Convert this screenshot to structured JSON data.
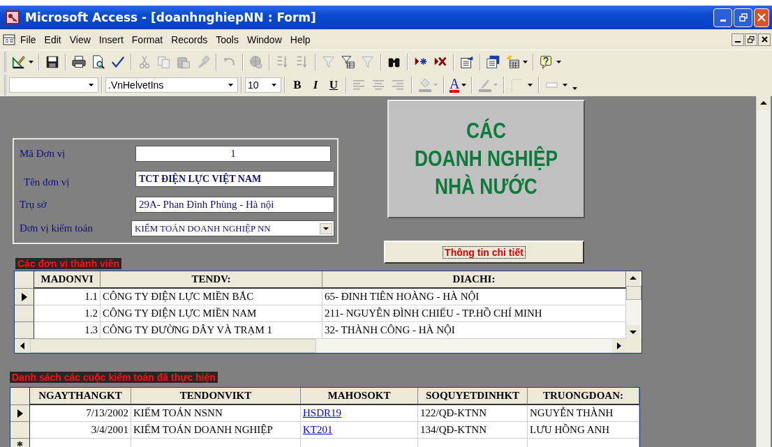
{
  "window": {
    "title": "Microsoft Access - [doanhnghiepNN : Form]"
  },
  "menu": [
    {
      "label": "File"
    },
    {
      "label": "Edit"
    },
    {
      "label": "View"
    },
    {
      "label": "Insert"
    },
    {
      "label": "Format"
    },
    {
      "label": "Records"
    },
    {
      "label": "Tools"
    },
    {
      "label": "Window"
    },
    {
      "label": "Help"
    }
  ],
  "formatting_toolbar": {
    "font": ".VnHelvetIns",
    "size": "10",
    "bold": "B",
    "italic": "I",
    "underline": "U",
    "font_color": "A"
  },
  "form": {
    "header": [
      "CÁC",
      "DOANH NGHIỆP",
      "NHÀ NƯỚC"
    ],
    "fields": [
      {
        "label": "Mã Đơn vị",
        "value": "1",
        "kind": "number"
      },
      {
        "label": "Tên đơn vị",
        "value": "TCT ĐIỆN LỰC VIỆT NAM",
        "kind": "bold"
      },
      {
        "label": "Trụ sở",
        "value": "29A- Phan Đình Phùng - Hà nội",
        "kind": "text"
      },
      {
        "label": "Đơn vị kiểm toán",
        "value": "KIẾM TOÁN DOANH NGHIỆP NN",
        "kind": "combo"
      }
    ],
    "detail_button": "Thông tin chi tiết",
    "members": {
      "title": "Các đơn vị thành viên",
      "columns": [
        "MADONVI",
        "TENDV:",
        "DIACHI:"
      ],
      "rows": [
        {
          "selected": true,
          "cells": [
            "1.1",
            "CÔNG TY ĐIỆN LỰC MIỀN BẮC",
            "65- ĐINH TIÊN HOÀNG - HÀ NỘI"
          ]
        },
        {
          "selected": false,
          "cells": [
            "1.2",
            "CÔNG TY ĐIỆN LỰC MIỀN NAM",
            "211- NGUYỄN ĐÌNH CHIẾU - TP.HỒ CHÍ MINH"
          ]
        },
        {
          "selected": false,
          "cells": [
            "1.3",
            "CÔNG TY ĐƯỜNG DÂY VÀ TRẠM 1",
            "32- THÀNH CÔNG - HÀ NỘI"
          ]
        }
      ]
    },
    "audits": {
      "title": "Danh sách các cuộc kiểm toán đã thực hiện",
      "columns": [
        "NGAYTHANGKT",
        "TENDONVIKT",
        "MAHOSOKT",
        "SOQUYETDINHKT",
        "TRUONGDOAN:"
      ],
      "rows": [
        {
          "selected": true,
          "cells": [
            "7/13/2002",
            "KIẾM TOÁN NSNN",
            "HSDR19",
            "122/QĐ-KTNN",
            "NGUYỄN THÀNH"
          ]
        },
        {
          "selected": false,
          "cells": [
            "3/4/2001",
            "KIẾM TOÁN DOANH NGHIỆP",
            "KT201",
            "134/QĐ-KTNN",
            "LƯU HỒNG ANH"
          ]
        }
      ],
      "new_record_mark": "*"
    }
  }
}
